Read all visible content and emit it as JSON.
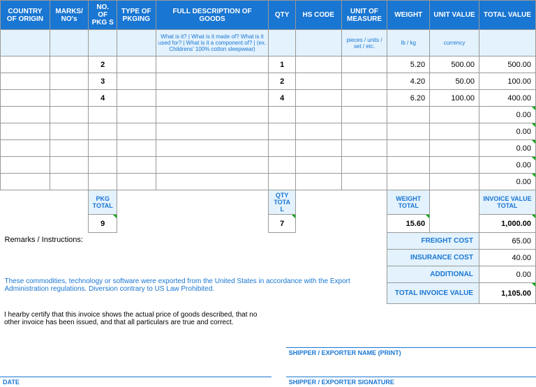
{
  "columns": [
    "COUNTRY OF ORIGIN",
    "MARKS/ NO's",
    "NO. OF PKG S",
    "TYPE OF PKGING",
    "FULL DESCRIPTION OF GOODS",
    "QTY",
    "HS CODE",
    "UNIT OF MEASURE",
    "WEIGHT",
    "UNIT VALUE",
    "TOTAL VALUE"
  ],
  "hints": [
    "",
    "",
    "",
    "",
    "What is it? | What is it made of? What is it used for? | What is it a component of? | (ex. Childrens' 100% cotton sleepwear)",
    "",
    "",
    "pieces / units / set / etc.",
    "lb / kg",
    "currency",
    ""
  ],
  "rows": [
    {
      "pkgs": "2",
      "qty": "1",
      "weight": "5.20",
      "unit": "500.00",
      "total": "500.00"
    },
    {
      "pkgs": "3",
      "qty": "2",
      "weight": "4.20",
      "unit": "50.00",
      "total": "100.00"
    },
    {
      "pkgs": "4",
      "qty": "4",
      "weight": "6.20",
      "unit": "100.00",
      "total": "400.00"
    },
    {
      "total": "0.00"
    },
    {
      "total": "0.00"
    },
    {
      "total": "0.00"
    },
    {
      "total": "0.00"
    },
    {
      "total": "0.00"
    }
  ],
  "totals": {
    "pkg_label": "PKG TOTAL",
    "pkg": "9",
    "qty_label": "QTY TOTA L",
    "qty": "7",
    "weight_label": "WEIGHT TOTAL",
    "weight": "15.60",
    "inv_label": "INVOICE VALUE TOTAL",
    "inv": "1,000.00"
  },
  "remarks_label": "Remarks / Instructions:",
  "summary": {
    "freight_label": "FREIGHT COST",
    "freight": "65.00",
    "insurance_label": "INSURANCE COST",
    "insurance": "40.00",
    "additional_label": "ADDITIONAL",
    "additional": "0.00",
    "total_label": "TOTAL INVOICE VALUE",
    "total": "1,105.00"
  },
  "disclaimer": "These commodities, technology or software were exported from the United States in accordance with the Export Administration regulations.  Diversion contrary to US Law Prohibited.",
  "cert": "I hearby certify that this invoice shows the actual price of goods described, that no other invoice has been issued, and that all particulars are true and correct.",
  "date_label": "DATE",
  "shipper_name": "SHIPPER / EXPORTER NAME (PRINT)",
  "shipper_sig": "SHIPPER / EXPORTER SIGNATURE"
}
